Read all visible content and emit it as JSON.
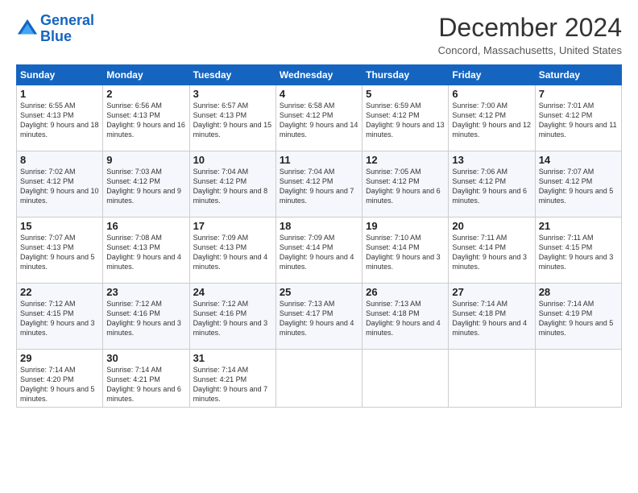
{
  "header": {
    "logo_line1": "General",
    "logo_line2": "Blue",
    "month_title": "December 2024",
    "location": "Concord, Massachusetts, United States"
  },
  "weekdays": [
    "Sunday",
    "Monday",
    "Tuesday",
    "Wednesday",
    "Thursday",
    "Friday",
    "Saturday"
  ],
  "weeks": [
    [
      {
        "day": "1",
        "sunrise": "6:55 AM",
        "sunset": "4:13 PM",
        "daylight": "9 hours and 18 minutes."
      },
      {
        "day": "2",
        "sunrise": "6:56 AM",
        "sunset": "4:13 PM",
        "daylight": "9 hours and 16 minutes."
      },
      {
        "day": "3",
        "sunrise": "6:57 AM",
        "sunset": "4:13 PM",
        "daylight": "9 hours and 15 minutes."
      },
      {
        "day": "4",
        "sunrise": "6:58 AM",
        "sunset": "4:12 PM",
        "daylight": "9 hours and 14 minutes."
      },
      {
        "day": "5",
        "sunrise": "6:59 AM",
        "sunset": "4:12 PM",
        "daylight": "9 hours and 13 minutes."
      },
      {
        "day": "6",
        "sunrise": "7:00 AM",
        "sunset": "4:12 PM",
        "daylight": "9 hours and 12 minutes."
      },
      {
        "day": "7",
        "sunrise": "7:01 AM",
        "sunset": "4:12 PM",
        "daylight": "9 hours and 11 minutes."
      }
    ],
    [
      {
        "day": "8",
        "sunrise": "7:02 AM",
        "sunset": "4:12 PM",
        "daylight": "9 hours and 10 minutes."
      },
      {
        "day": "9",
        "sunrise": "7:03 AM",
        "sunset": "4:12 PM",
        "daylight": "9 hours and 9 minutes."
      },
      {
        "day": "10",
        "sunrise": "7:04 AM",
        "sunset": "4:12 PM",
        "daylight": "9 hours and 8 minutes."
      },
      {
        "day": "11",
        "sunrise": "7:04 AM",
        "sunset": "4:12 PM",
        "daylight": "9 hours and 7 minutes."
      },
      {
        "day": "12",
        "sunrise": "7:05 AM",
        "sunset": "4:12 PM",
        "daylight": "9 hours and 6 minutes."
      },
      {
        "day": "13",
        "sunrise": "7:06 AM",
        "sunset": "4:12 PM",
        "daylight": "9 hours and 6 minutes."
      },
      {
        "day": "14",
        "sunrise": "7:07 AM",
        "sunset": "4:12 PM",
        "daylight": "9 hours and 5 minutes."
      }
    ],
    [
      {
        "day": "15",
        "sunrise": "7:07 AM",
        "sunset": "4:13 PM",
        "daylight": "9 hours and 5 minutes."
      },
      {
        "day": "16",
        "sunrise": "7:08 AM",
        "sunset": "4:13 PM",
        "daylight": "9 hours and 4 minutes."
      },
      {
        "day": "17",
        "sunrise": "7:09 AM",
        "sunset": "4:13 PM",
        "daylight": "9 hours and 4 minutes."
      },
      {
        "day": "18",
        "sunrise": "7:09 AM",
        "sunset": "4:14 PM",
        "daylight": "9 hours and 4 minutes."
      },
      {
        "day": "19",
        "sunrise": "7:10 AM",
        "sunset": "4:14 PM",
        "daylight": "9 hours and 3 minutes."
      },
      {
        "day": "20",
        "sunrise": "7:11 AM",
        "sunset": "4:14 PM",
        "daylight": "9 hours and 3 minutes."
      },
      {
        "day": "21",
        "sunrise": "7:11 AM",
        "sunset": "4:15 PM",
        "daylight": "9 hours and 3 minutes."
      }
    ],
    [
      {
        "day": "22",
        "sunrise": "7:12 AM",
        "sunset": "4:15 PM",
        "daylight": "9 hours and 3 minutes."
      },
      {
        "day": "23",
        "sunrise": "7:12 AM",
        "sunset": "4:16 PM",
        "daylight": "9 hours and 3 minutes."
      },
      {
        "day": "24",
        "sunrise": "7:12 AM",
        "sunset": "4:16 PM",
        "daylight": "9 hours and 3 minutes."
      },
      {
        "day": "25",
        "sunrise": "7:13 AM",
        "sunset": "4:17 PM",
        "daylight": "9 hours and 4 minutes."
      },
      {
        "day": "26",
        "sunrise": "7:13 AM",
        "sunset": "4:18 PM",
        "daylight": "9 hours and 4 minutes."
      },
      {
        "day": "27",
        "sunrise": "7:14 AM",
        "sunset": "4:18 PM",
        "daylight": "9 hours and 4 minutes."
      },
      {
        "day": "28",
        "sunrise": "7:14 AM",
        "sunset": "4:19 PM",
        "daylight": "9 hours and 5 minutes."
      }
    ],
    [
      {
        "day": "29",
        "sunrise": "7:14 AM",
        "sunset": "4:20 PM",
        "daylight": "9 hours and 5 minutes."
      },
      {
        "day": "30",
        "sunrise": "7:14 AM",
        "sunset": "4:21 PM",
        "daylight": "9 hours and 6 minutes."
      },
      {
        "day": "31",
        "sunrise": "7:14 AM",
        "sunset": "4:21 PM",
        "daylight": "9 hours and 7 minutes."
      },
      null,
      null,
      null,
      null
    ]
  ]
}
